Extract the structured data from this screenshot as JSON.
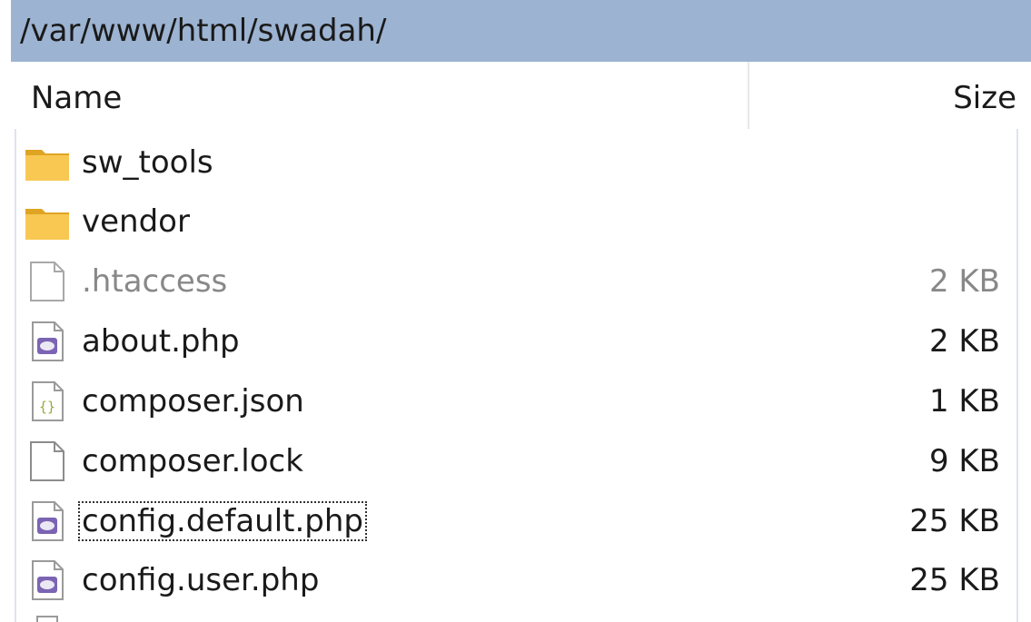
{
  "path": "/var/www/html/swadah/",
  "columns": {
    "name": "Name",
    "size": "Size"
  },
  "files": [
    {
      "name": "sw_tools",
      "size": "",
      "icon": "folder-icon"
    },
    {
      "name": "vendor",
      "size": "",
      "icon": "folder-icon"
    },
    {
      "name": ".htaccess",
      "size": "2 KB",
      "icon": "hidden-file-icon"
    },
    {
      "name": "about.php",
      "size": "2 KB",
      "icon": "php-file-icon"
    },
    {
      "name": "composer.json",
      "size": "1 KB",
      "icon": "json-file-icon"
    },
    {
      "name": "composer.lock",
      "size": "9 KB",
      "icon": "blank-file-icon"
    },
    {
      "name": "config.default.php",
      "size": "25 KB",
      "icon": "php-file-icon"
    },
    {
      "name": "config.user.php",
      "size": "25 KB",
      "icon": "php-file-icon"
    }
  ],
  "colors": {
    "pathbar": "#9cb3d1",
    "folder": "#f5c04a",
    "php": "#7b64b3",
    "json": "#9aa93a"
  }
}
